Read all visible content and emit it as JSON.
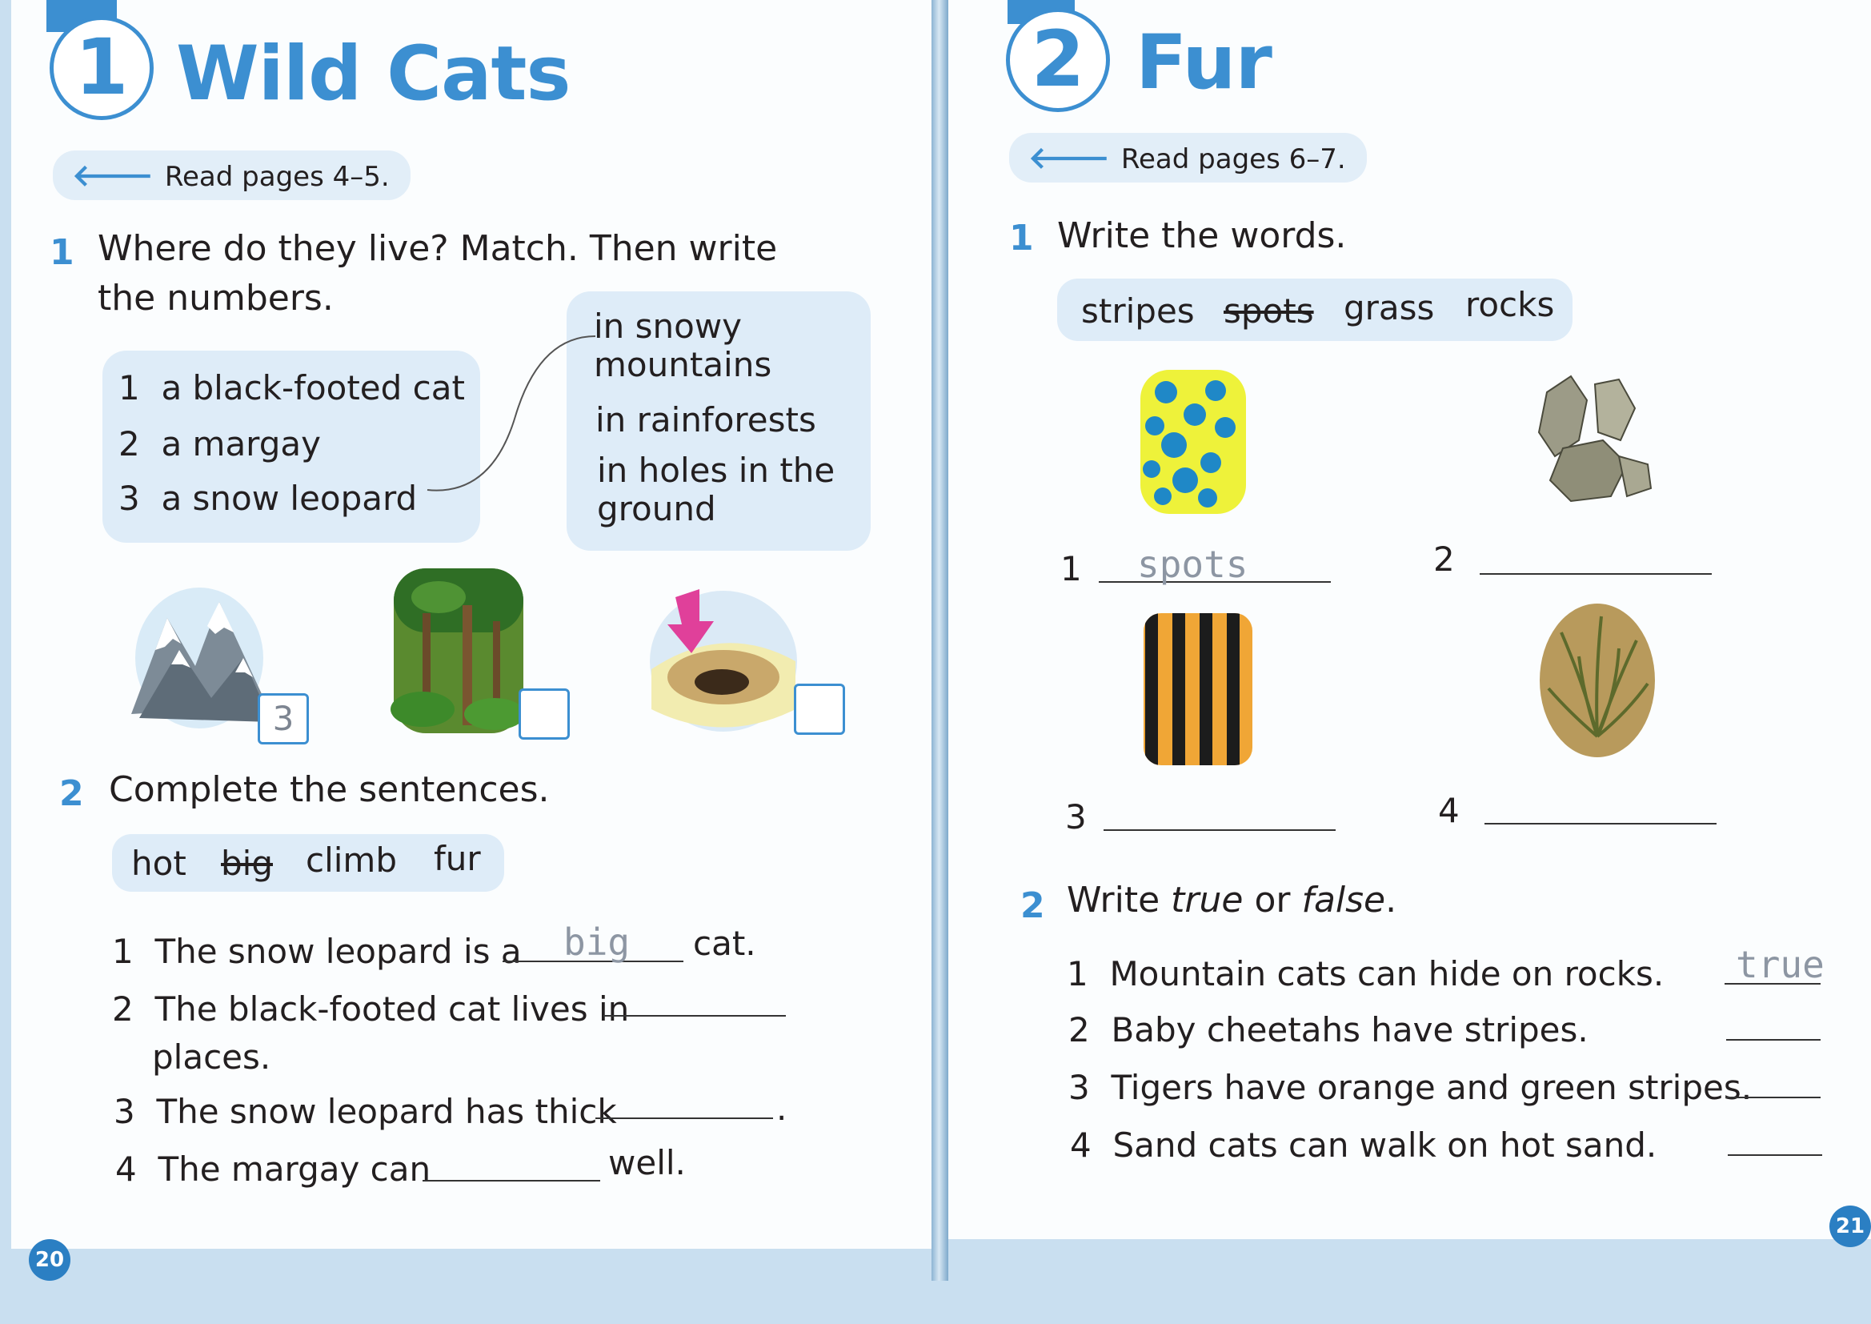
{
  "left": {
    "unit_number": "1",
    "unit_title": "Wild Cats",
    "read_pages": "Read pages 4–5.",
    "ex1": {
      "number": "1",
      "instruction_line1": "Where do they live? Match. Then write",
      "instruction_line2": "the numbers.",
      "animals": [
        {
          "num": "1",
          "text": "a black-footed cat"
        },
        {
          "num": "2",
          "text": "a margay"
        },
        {
          "num": "3",
          "text": "a snow leopard"
        }
      ],
      "habitats": [
        {
          "line1": "in snowy",
          "line2": "mountains"
        },
        {
          "line1": "in rainforests",
          "line2": ""
        },
        {
          "line1": "in holes in the",
          "line2": "ground"
        }
      ],
      "box_answers": [
        "3",
        "",
        ""
      ],
      "pictures": [
        "mountain-picture",
        "rainforest-picture",
        "hole-picture"
      ]
    },
    "ex2": {
      "number": "2",
      "instruction": "Complete the sentences.",
      "word_bank": [
        "hot",
        "big",
        "climb",
        "fur"
      ],
      "crossed_word": "big",
      "sentences": [
        {
          "num": "1",
          "before": "The snow leopard is a",
          "answer": "big",
          "after": "cat."
        },
        {
          "num": "2",
          "before": "The black-footed cat lives in",
          "answer": "",
          "after": "",
          "line2": "places."
        },
        {
          "num": "3",
          "before": "The snow leopard has thick",
          "answer": "",
          "after": "."
        },
        {
          "num": "4",
          "before": "The margay can",
          "answer": "",
          "after": "well."
        }
      ]
    },
    "page_number": "20"
  },
  "right": {
    "unit_number": "2",
    "unit_title": "Fur",
    "read_pages": "Read pages 6–7.",
    "ex1": {
      "number": "1",
      "instruction": "Write the words.",
      "word_bank": [
        "stripes",
        "spots",
        "grass",
        "rocks"
      ],
      "crossed_word": "spots",
      "items": [
        {
          "num": "1",
          "answer": "spots",
          "picture": "spots-picture"
        },
        {
          "num": "2",
          "answer": "",
          "picture": "rocks-picture"
        },
        {
          "num": "3",
          "answer": "",
          "picture": "stripes-picture"
        },
        {
          "num": "4",
          "answer": "",
          "picture": "grass-picture"
        }
      ]
    },
    "ex2": {
      "number": "2",
      "instruction_prefix": "Write ",
      "instruction_true": "true",
      "instruction_mid": " or ",
      "instruction_false": "false",
      "instruction_suffix": ".",
      "statements": [
        {
          "num": "1",
          "text": "Mountain cats can hide on rocks.",
          "answer": "true"
        },
        {
          "num": "2",
          "text": "Baby cheetahs have stripes.",
          "answer": ""
        },
        {
          "num": "3",
          "text": "Tigers have orange and green stripes.",
          "answer": ""
        },
        {
          "num": "4",
          "text": "Sand cats can walk on hot sand.",
          "answer": ""
        }
      ]
    },
    "page_number": "21"
  },
  "colors": {
    "accent": "#3c8fd1",
    "box_fill": "#deecf8",
    "spots_bg": "#eef23a",
    "spots_dot": "#1f88c7",
    "stripe_orange": "#f0a636",
    "handwriting": "#8d96a3"
  }
}
